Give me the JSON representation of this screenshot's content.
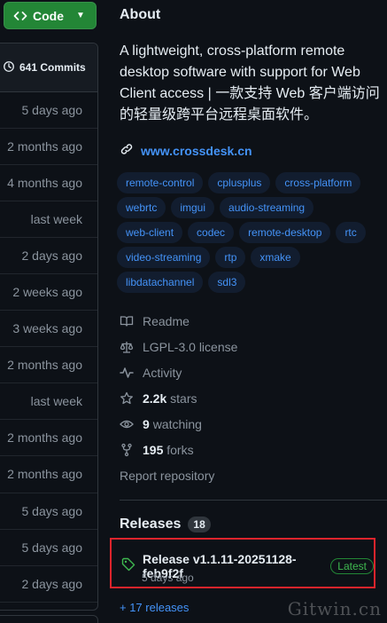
{
  "code_button": {
    "label": "Code"
  },
  "commits": {
    "count_label": "641 Commits",
    "rows": [
      "5 days ago",
      "2 months ago",
      "4 months ago",
      "last week",
      "2 days ago",
      "2 weeks ago",
      "3 weeks ago",
      "2 months ago",
      "last week",
      "2 months ago",
      "2 months ago",
      "5 days ago",
      "5 days ago",
      "2 days ago"
    ]
  },
  "about": {
    "title": "About",
    "description": "A lightweight, cross-platform remote desktop software with support for Web Client access | 一款支持 Web 客户端访问的轻量级跨平台远程桌面软件。",
    "homepage": "www.crossdesk.cn",
    "topics": [
      "remote-control",
      "cplusplus",
      "cross-platform",
      "webrtc",
      "imgui",
      "audio-streaming",
      "web-client",
      "codec",
      "remote-desktop",
      "rtc",
      "video-streaming",
      "rtp",
      "xmake",
      "libdatachannel",
      "sdl3"
    ]
  },
  "meta": {
    "readme": "Readme",
    "license": "LGPL-3.0 license",
    "activity": "Activity",
    "stars_value": "2.2k",
    "stars_label": "stars",
    "watching_value": "9",
    "watching_label": "watching",
    "forks_value": "195",
    "forks_label": "forks",
    "report": "Report repository"
  },
  "releases": {
    "title": "Releases",
    "count": "18",
    "latest_name": "Release v1.1.11-20251128-feb9f2f",
    "latest_badge": "Latest",
    "latest_date": "5 days ago",
    "more": "+ 17 releases"
  },
  "watermark": "Gitwin.cn",
  "colors": {
    "background": "#0d1117",
    "accent_link": "#4493f8",
    "topic_bg": "#121d2f",
    "green": "#238636",
    "highlight_red": "#e0242c"
  }
}
